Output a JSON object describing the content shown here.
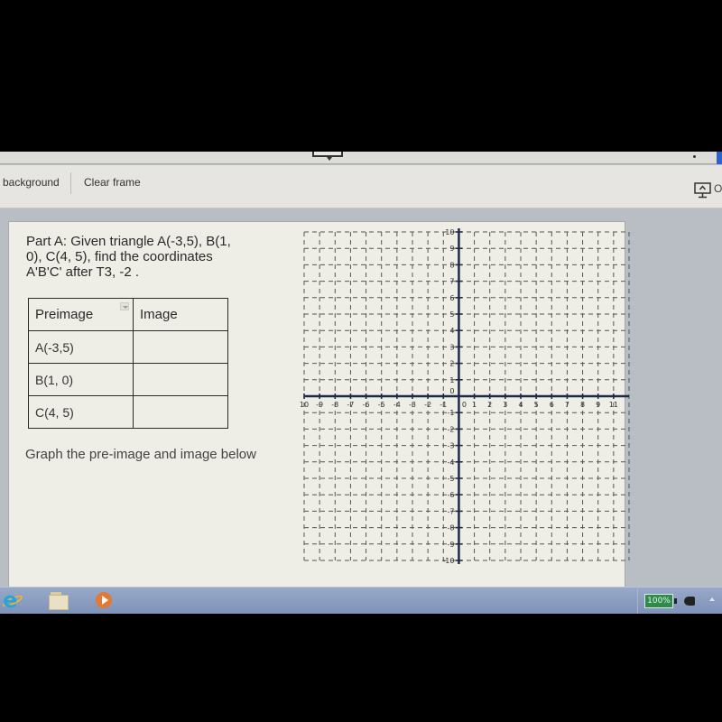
{
  "toolbar": {
    "background_label": "background",
    "clear_frame_label": "Clear frame",
    "present_label": "O",
    "present_icon": "present-screen-icon"
  },
  "question": {
    "text": "Part A:  Given triangle A(-3,5), B(1, 0), C(4, 5), find the coordinates A'B'C' after T3, -2 ."
  },
  "table": {
    "headers": [
      "Preimage",
      "Image"
    ],
    "rows": [
      {
        "preimage": "A(-3,5)",
        "image": ""
      },
      {
        "preimage": "B(1, 0)",
        "image": ""
      },
      {
        "preimage": "C(4, 5)",
        "image": ""
      }
    ]
  },
  "instruction": "Graph the pre-image and image below",
  "graph": {
    "x_range": [
      -10,
      11
    ],
    "y_range": [
      -10,
      10
    ],
    "x_tick_labels": [
      "10",
      "-9",
      "-8",
      "-7",
      "-6",
      "-5",
      "-4",
      "-3",
      "-2",
      "-1",
      "0",
      "1",
      "2",
      "3",
      "4",
      "5",
      "6",
      "7",
      "8",
      "9",
      "11"
    ],
    "y_tick_labels": [
      "10",
      "9",
      "8",
      "7",
      "6",
      "5",
      "4",
      "3",
      "2",
      "1",
      "0",
      "-1",
      "-2",
      "-3",
      "-4",
      "-5",
      "-6",
      "-7",
      "-8",
      "-9",
      "-10"
    ],
    "grid": "dashed"
  },
  "taskbar": {
    "apps": [
      "internet-explorer",
      "file-explorer",
      "media-player"
    ],
    "battery": "100%"
  }
}
